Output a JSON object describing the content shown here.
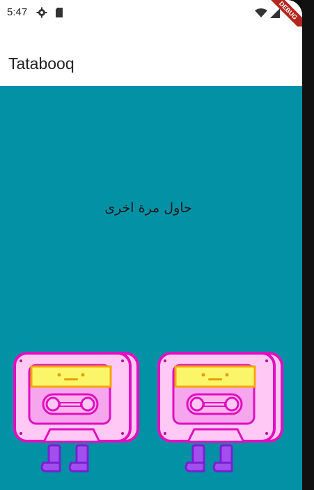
{
  "status_bar": {
    "time": "5:47",
    "icons": [
      "gear-icon",
      "sd-card-icon",
      "wifi-icon",
      "signal-icon"
    ]
  },
  "app_bar": {
    "title": "Tatabooq"
  },
  "main": {
    "message": "حاول مرة اخرى",
    "background_color": "#0391a6",
    "cassettes": [
      {
        "name": "cassette-character-left"
      },
      {
        "name": "cassette-character-right"
      }
    ]
  },
  "debug_banner": {
    "label": "DEBUG",
    "color": "#b3261e"
  },
  "colors": {
    "cassette_body": "#ffc8f5",
    "cassette_outline": "#e10fbf",
    "cassette_label": "#fbf56a",
    "cassette_label_border": "#f5a50a",
    "legs": "#8a32e0"
  }
}
